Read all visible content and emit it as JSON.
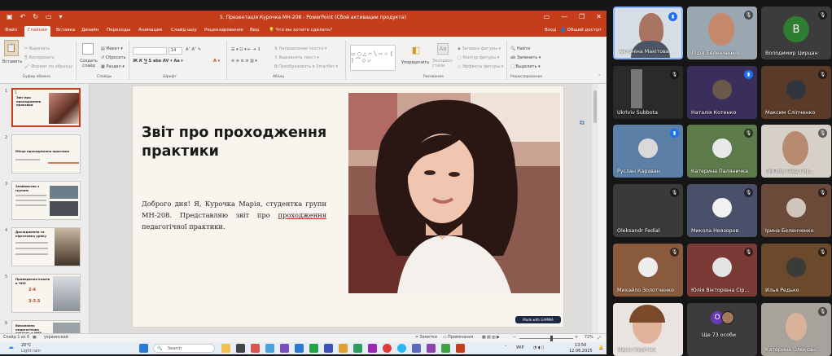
{
  "window": {
    "title": "5. Презентація Курочка МН-208 - PowerPoint (Сбой активации продукта)",
    "signin": "Вход",
    "share": "Общий доступ"
  },
  "tabs": [
    "Файл",
    "Главная",
    "Вставка",
    "Дизайн",
    "Переходы",
    "Анимация",
    "Слайд-шоу",
    "Рецензирование",
    "Вид",
    "Что вы хотите сделать?"
  ],
  "ribbon": {
    "paste": "Вставить",
    "cut": "Вырезать",
    "copy": "Копировать",
    "format_painter": "Формат по образцу",
    "clipboard_group": "Буфер обмена",
    "new_slide": "Создать слайд",
    "layout": "Макет",
    "reset": "Сбросить",
    "section": "Раздел",
    "slides_group": "Слайды",
    "font_group": "Шрифт",
    "font_size": "14",
    "text_direction": "Направление текста",
    "align_text": "Выровнять текст",
    "smartart": "Преобразовать в SmartArt",
    "paragraph_group": "Абзац",
    "arrange": "Упорядочить",
    "quick_styles": "Экспресс-стили",
    "shape_fill": "Заливка фигуры",
    "shape_outline": "Контур фигуры",
    "shape_effects": "Эффекты фигуры",
    "drawing_group": "Рисование",
    "find": "Найти",
    "replace": "Заменить",
    "select": "Выделить",
    "editing_group": "Редактирование"
  },
  "thumbnails": [
    {
      "num": "1",
      "title": "Звіт про проходження практики"
    },
    {
      "num": "2",
      "title": "Місце проходження практики"
    },
    {
      "num": "3",
      "title": "Знайомство з групою"
    },
    {
      "num": "4",
      "title": "Дослідження та підготовка уроку"
    },
    {
      "num": "5",
      "title": "Проведення класів в ЧНУ",
      "stat1": "2-4",
      "stat2": "3-3.5"
    },
    {
      "num": "6",
      "title": "Виконання педагогічних завдань в ЧНУ"
    }
  ],
  "slide": {
    "title": "Звіт про проходження практики",
    "body_before": "Доброго дня! Я, Курочка Марія, студентка групи МН-208. Представляю звіт про ",
    "body_underlined": "проходження",
    "body_after": " педагогічної практики.",
    "badge": "Made with GAMMA"
  },
  "status": {
    "slide_info": "Слайд 1 из 6",
    "language": "украинский",
    "notes": "Заметки",
    "comments": "Примечания",
    "zoom": "72%"
  },
  "taskbar": {
    "temp": "20°C",
    "weather": "Light rain",
    "search": "Search",
    "lang": "УКР",
    "time": "13:50",
    "date": "12.06.2025"
  },
  "participants": [
    {
      "name": "Антоніна Макітова",
      "mic": "on"
    },
    {
      "name": "Лідія Беленченко",
      "mic": "off"
    },
    {
      "name": "Володимир Цирцан",
      "mic": "off",
      "letter": "В",
      "color": "#2e7d32"
    },
    {
      "name": "Ukrlviv Subbota",
      "mic": "off"
    },
    {
      "name": "Наталія Котенко",
      "mic": "on"
    },
    {
      "name": "Максим Сліпченко",
      "mic": "off"
    },
    {
      "name": "Руслан Караван",
      "mic": "on"
    },
    {
      "name": "Катерина Паляничка",
      "mic": "off"
    },
    {
      "name": "ПНПФК Пищ Гор...",
      "mic": "off"
    },
    {
      "name": "Oleksandr Fedial",
      "mic": "off"
    },
    {
      "name": "Микола Неязоров",
      "mic": "off"
    },
    {
      "name": "Ірина Беленченко",
      "mic": "off"
    },
    {
      "name": "Михайло Золотченко",
      "mic": "off"
    },
    {
      "name": "Юлія Вікторівна Сір...",
      "mic": "off"
    },
    {
      "name": "Илья Редько",
      "mic": "off"
    },
    {
      "name": "Марія Курочка",
      "mic": "off"
    },
    {
      "name": "Ще 73 особи",
      "letter": "О"
    },
    {
      "name": "Катерина Олексан...",
      "mic": "off"
    }
  ]
}
